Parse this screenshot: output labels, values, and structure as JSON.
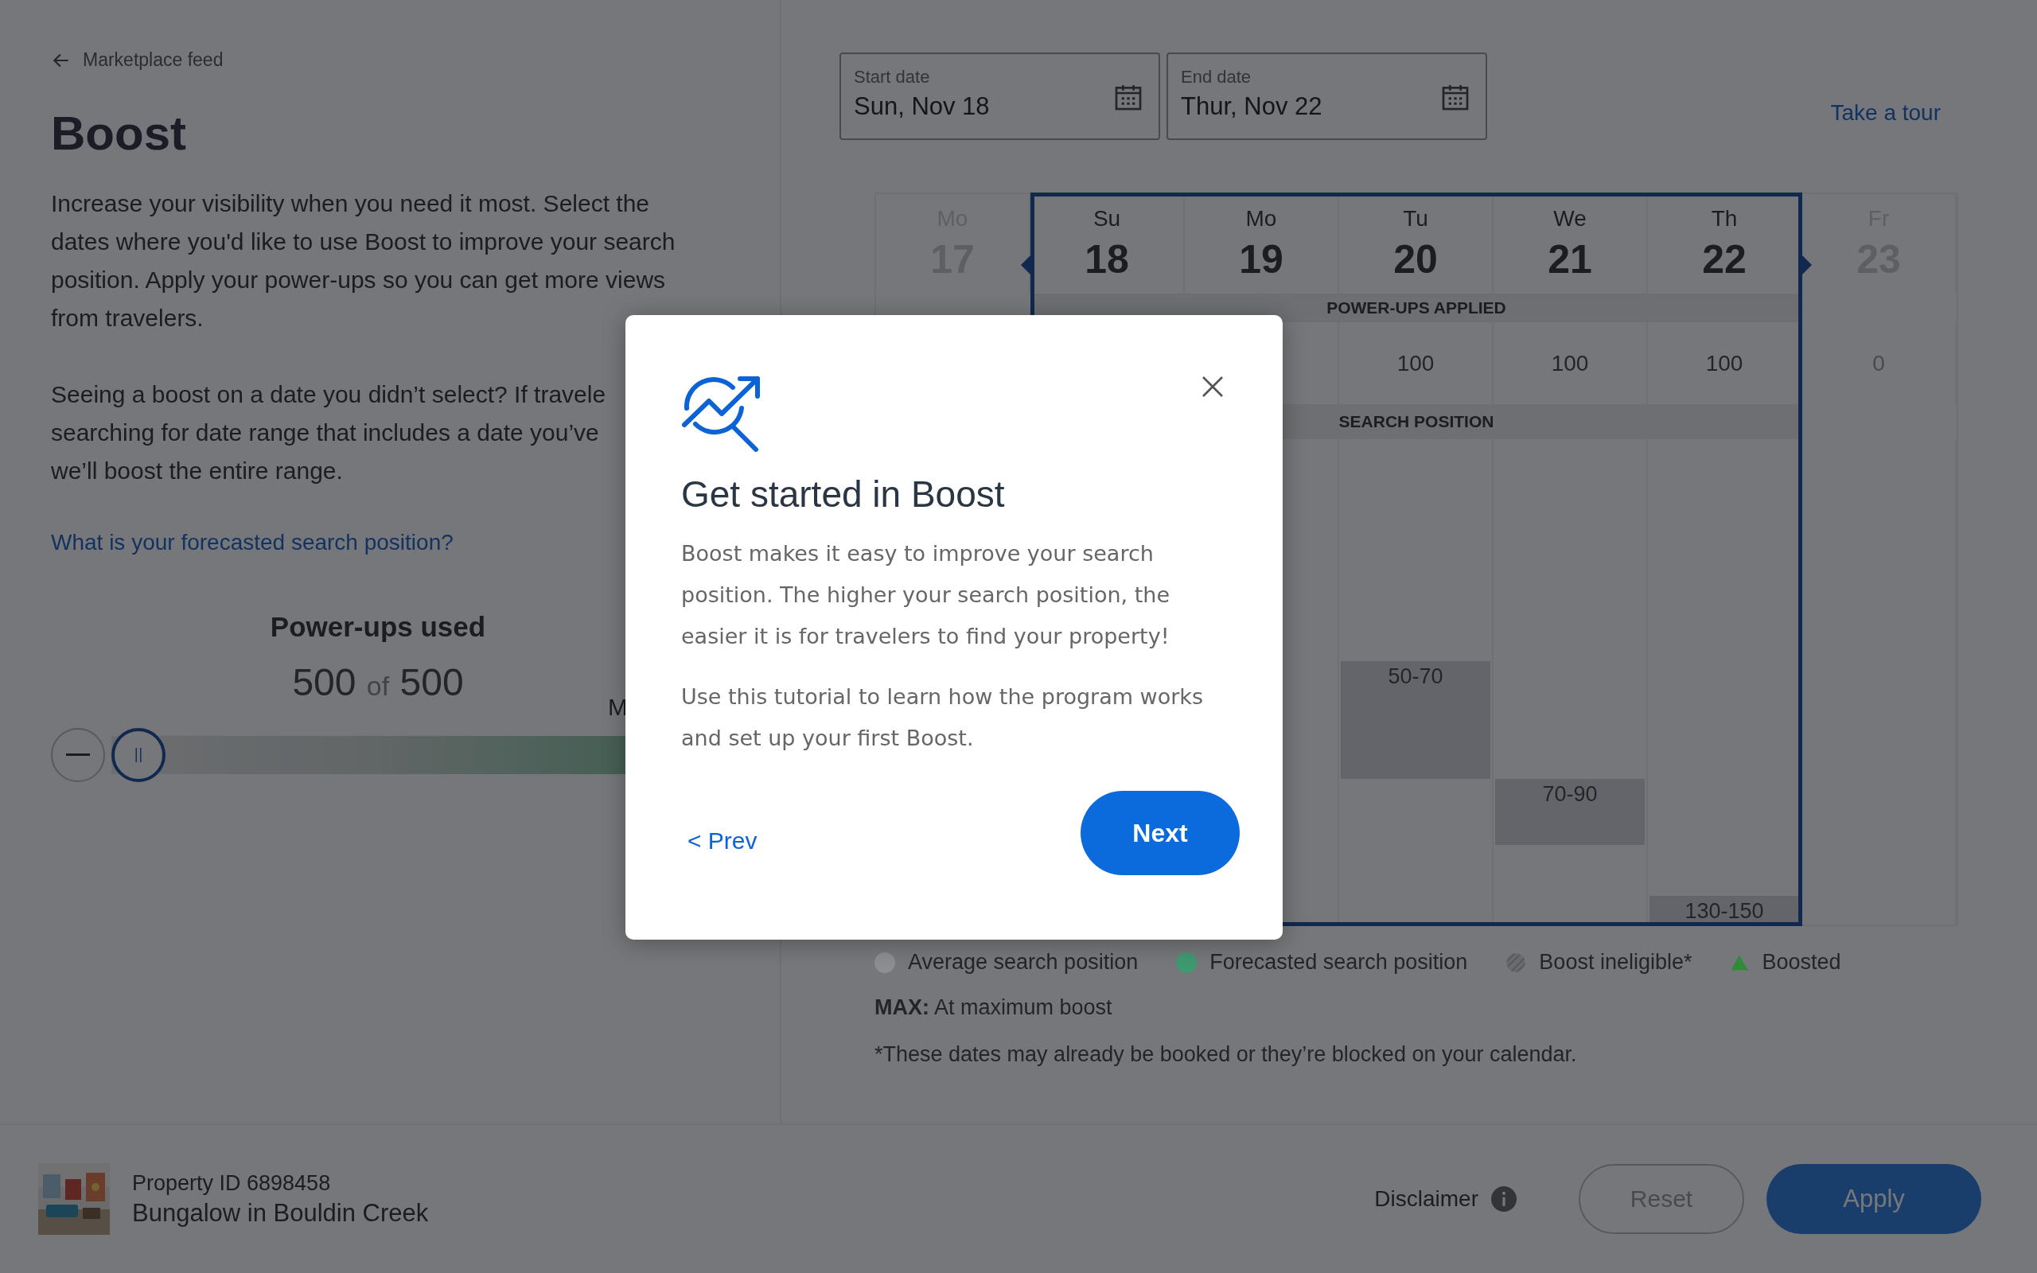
{
  "back_link": {
    "label": "Marketplace feed"
  },
  "title": "Boost",
  "intro": {
    "lines": [
      "Increase your visibility when you need it most. Select the",
      "dates where you'd like to use Boost to improve your search",
      "position. Apply your power-ups so you can get more views",
      "from travelers."
    ]
  },
  "note": {
    "lines": [
      "Seeing a boost on a date you didn’t select? If travele",
      "searching for date range that includes a date you’ve",
      "we’ll boost the entire range."
    ]
  },
  "forecast_link": "What is your forecasted search position?",
  "power_ups": {
    "heading": "Power-ups used",
    "used": "500",
    "of": "of",
    "total": "500",
    "side_label": "M",
    "slider": {
      "level": 0
    }
  },
  "dates": {
    "start": {
      "label": "Start date",
      "value": "Sun, Nov 18"
    },
    "end": {
      "label": "End date",
      "value": "Thur, Nov 22"
    }
  },
  "tour_link": "Take a tour",
  "calendar": {
    "powerups_heading": "POWER-UPS APPLIED",
    "search_heading": "SEARCH POSITION",
    "days": [
      {
        "weekday": "Mo",
        "date": "17",
        "selected": false
      },
      {
        "weekday": "Su",
        "date": "18",
        "selected": true
      },
      {
        "weekday": "Mo",
        "date": "19",
        "selected": true
      },
      {
        "weekday": "Tu",
        "date": "20",
        "selected": true,
        "power_ups": "100",
        "position": "50-70"
      },
      {
        "weekday": "We",
        "date": "21",
        "selected": true,
        "power_ups": "100",
        "position": "70-90"
      },
      {
        "weekday": "Th",
        "date": "22",
        "selected": true,
        "power_ups": "100",
        "position": "130-150"
      },
      {
        "weekday": "Fr",
        "date": "23",
        "selected": false,
        "power_ups": "0"
      }
    ]
  },
  "legend": [
    {
      "kind": "dot",
      "label": "Average search position",
      "color": "#8d8e91"
    },
    {
      "kind": "dot",
      "label": "Forecasted search position",
      "color": "#3f9a70"
    },
    {
      "kind": "hatched",
      "label": "Boost ineligible*"
    },
    {
      "kind": "triangle",
      "label": "Boosted",
      "color": "#2e8b3a"
    }
  ],
  "max_note": {
    "key": "MAX:",
    "text": "At maximum boost"
  },
  "footnote": "*These dates may already be booked or they’re blocked on your calendar.",
  "property": {
    "id": "Property ID 6898458",
    "name": "Bungalow in Bouldin Creek"
  },
  "disclaimer": "Disclaimer",
  "buttons": {
    "reset": {
      "label": "Reset",
      "disabled": true
    },
    "apply": {
      "label": "Apply",
      "disabled": false
    }
  },
  "modal": {
    "title": "Get started in Boost",
    "paragraphs": [
      "Boost makes it easy to improve your search position. The higher your search position, the easier it is for travelers to find your property!",
      "Use this tutorial to learn how the program works and set up your first Boost."
    ],
    "prev": "< Prev",
    "next": "Next"
  }
}
